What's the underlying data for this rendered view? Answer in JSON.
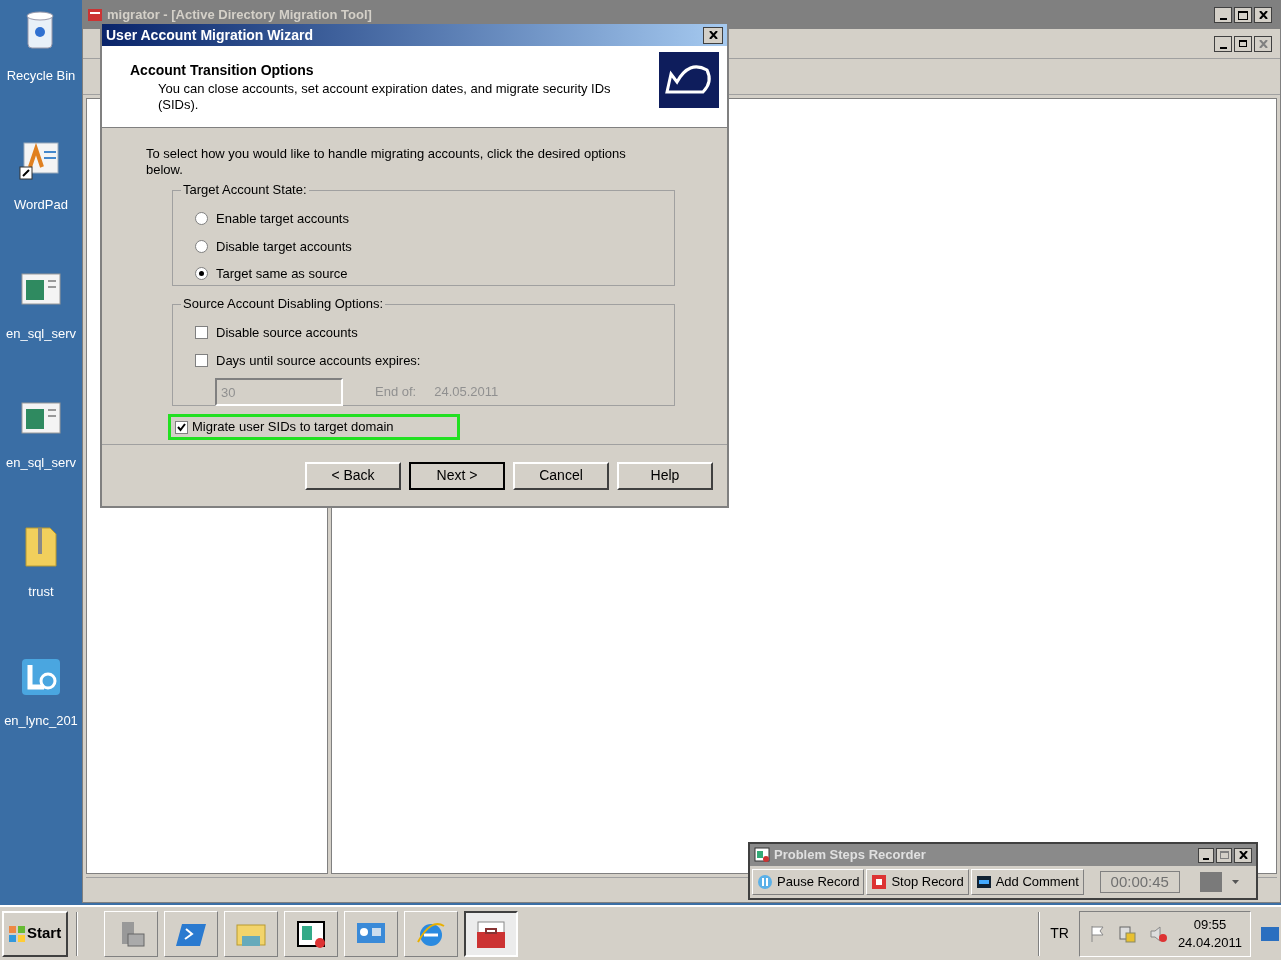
{
  "desktop_icons": [
    {
      "label": "Recycle Bin",
      "kind": "bin"
    },
    {
      "label": "WordPad",
      "kind": "wordpad"
    },
    {
      "label": "en_sql_serv",
      "kind": "app"
    },
    {
      "label": "en_sql_serv",
      "kind": "app"
    },
    {
      "label": "trust",
      "kind": "zip"
    },
    {
      "label": "en_lync_201",
      "kind": "lync"
    }
  ],
  "main_window": {
    "title": "migrator - [Active Directory Migration Tool]"
  },
  "wizard": {
    "title": "User Account Migration Wizard",
    "heading": "Account Transition Options",
    "subheading": "You can close accounts, set account expiration dates, and migrate security IDs (SIDs).",
    "intro": "To select how you would like to handle migrating accounts, click the desired options below.",
    "target_group": {
      "label": "Target Account State:",
      "options": [
        {
          "label": "Enable target accounts",
          "selected": false
        },
        {
          "label": "Disable target accounts",
          "selected": false
        },
        {
          "label": "Target same as source",
          "selected": true
        }
      ]
    },
    "source_group": {
      "label": "Source Account Disabling Options:",
      "options": [
        {
          "label": "Disable source accounts",
          "checked": false
        },
        {
          "label": "Days until source accounts expires:",
          "checked": false
        }
      ],
      "days_field": {
        "value": "30",
        "disabled": true
      },
      "end_label": "End of:",
      "end_date": "24.05.2011"
    },
    "migrate_sids": {
      "label": "Migrate user SIDs to target domain",
      "checked": true,
      "highlighted": true
    },
    "buttons": [
      {
        "label": "< Back",
        "default": false
      },
      {
        "label": "Next >",
        "default": true
      },
      {
        "label": "Cancel",
        "default": false
      },
      {
        "label": "Help",
        "default": false
      }
    ]
  },
  "recorder": {
    "title": "Problem Steps Recorder",
    "buttons": [
      {
        "label": "Pause Record",
        "kind": "pause"
      },
      {
        "label": "Stop Record",
        "kind": "stop"
      },
      {
        "label": "Add Comment",
        "kind": "comment"
      }
    ],
    "timer": "00:00:45"
  },
  "taskbar": {
    "start": "Start",
    "items": [
      {
        "kind": "server",
        "selected": false
      },
      {
        "kind": "shell",
        "selected": false
      },
      {
        "kind": "folder",
        "selected": false
      },
      {
        "kind": "recorder",
        "selected": false
      },
      {
        "kind": "panel",
        "selected": false
      },
      {
        "kind": "browser",
        "selected": false
      },
      {
        "kind": "toolbox",
        "selected": true
      }
    ],
    "language": "TR",
    "time": "09:55",
    "date": "24.04.2011"
  }
}
